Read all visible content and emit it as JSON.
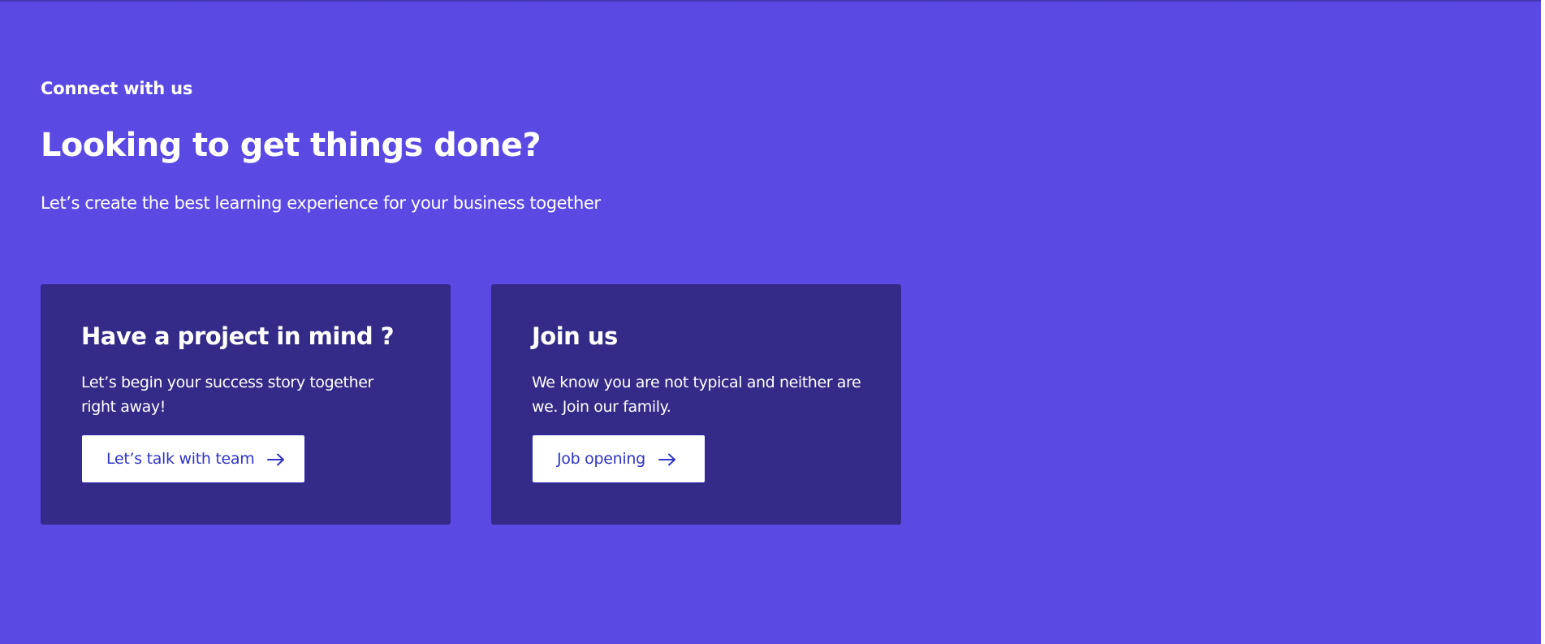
{
  "connect": {
    "eyebrow": "Connect with us",
    "headline": "Looking to get things done?",
    "subheadline": "Let’s create the best learning experience for your business together"
  },
  "cards": [
    {
      "title": "Have a project in mind ?",
      "text": "Let’s begin your success story together right away!",
      "button_label": "Let’s talk with team",
      "button_icon": "arrow-right-icon"
    },
    {
      "title": "Join us",
      "text": "We know you are not typical and neither are we. Join our family.",
      "button_label": "Job opening",
      "button_icon": "arrow-right-icon"
    }
  ],
  "colors": {
    "background": "#5a49e3",
    "card_background": "#342a87",
    "button_text": "#2f34c6",
    "text": "#ffffff"
  }
}
